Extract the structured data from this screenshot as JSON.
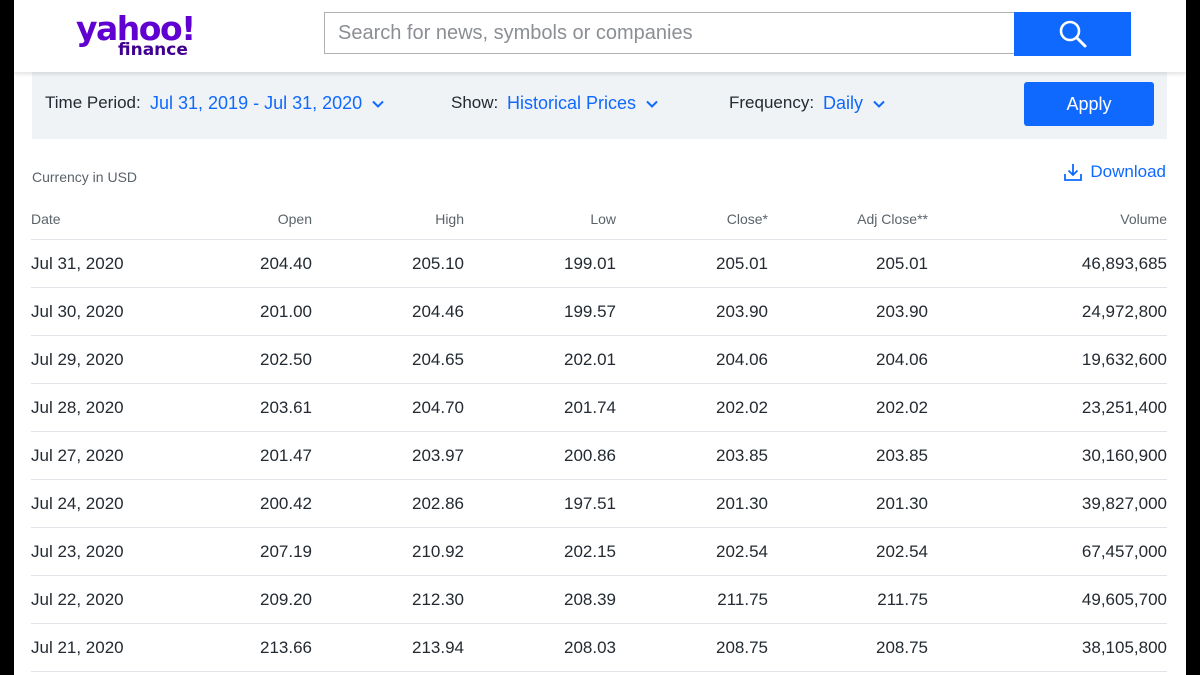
{
  "brand": {
    "logo_yahoo": "yahoo!",
    "logo_finance": "finance"
  },
  "search": {
    "placeholder": "Search for news, symbols or companies",
    "value": "",
    "button_icon": "search-icon"
  },
  "filters": {
    "time_period_label": "Time Period:",
    "time_period_value": "Jul 31, 2019 - Jul 31, 2020",
    "show_label": "Show:",
    "show_value": "Historical Prices",
    "frequency_label": "Frequency:",
    "frequency_value": "Daily",
    "apply_label": "Apply"
  },
  "currency_note": "Currency in USD",
  "download_label": "Download",
  "table": {
    "headers": [
      "Date",
      "Open",
      "High",
      "Low",
      "Close*",
      "Adj Close**",
      "Volume"
    ],
    "rows": [
      [
        "Jul 31, 2020",
        "204.40",
        "205.10",
        "199.01",
        "205.01",
        "205.01",
        "46,893,685"
      ],
      [
        "Jul 30, 2020",
        "201.00",
        "204.46",
        "199.57",
        "203.90",
        "203.90",
        "24,972,800"
      ],
      [
        "Jul 29, 2020",
        "202.50",
        "204.65",
        "202.01",
        "204.06",
        "204.06",
        "19,632,600"
      ],
      [
        "Jul 28, 2020",
        "203.61",
        "204.70",
        "201.74",
        "202.02",
        "202.02",
        "23,251,400"
      ],
      [
        "Jul 27, 2020",
        "201.47",
        "203.97",
        "200.86",
        "203.85",
        "203.85",
        "30,160,900"
      ],
      [
        "Jul 24, 2020",
        "200.42",
        "202.86",
        "197.51",
        "201.30",
        "201.30",
        "39,827,000"
      ],
      [
        "Jul 23, 2020",
        "207.19",
        "210.92",
        "202.15",
        "202.54",
        "202.54",
        "67,457,000"
      ],
      [
        "Jul 22, 2020",
        "209.20",
        "212.30",
        "208.39",
        "211.75",
        "211.75",
        "49,605,700"
      ],
      [
        "Jul 21, 2020",
        "213.66",
        "213.94",
        "208.03",
        "208.75",
        "208.75",
        "38,105,800"
      ]
    ]
  },
  "colors": {
    "accent": "#0f69ff",
    "brand_purple": "#6001d2",
    "filter_bg": "#f0f3f5",
    "text": "#232a31",
    "muted": "#5b636a"
  }
}
